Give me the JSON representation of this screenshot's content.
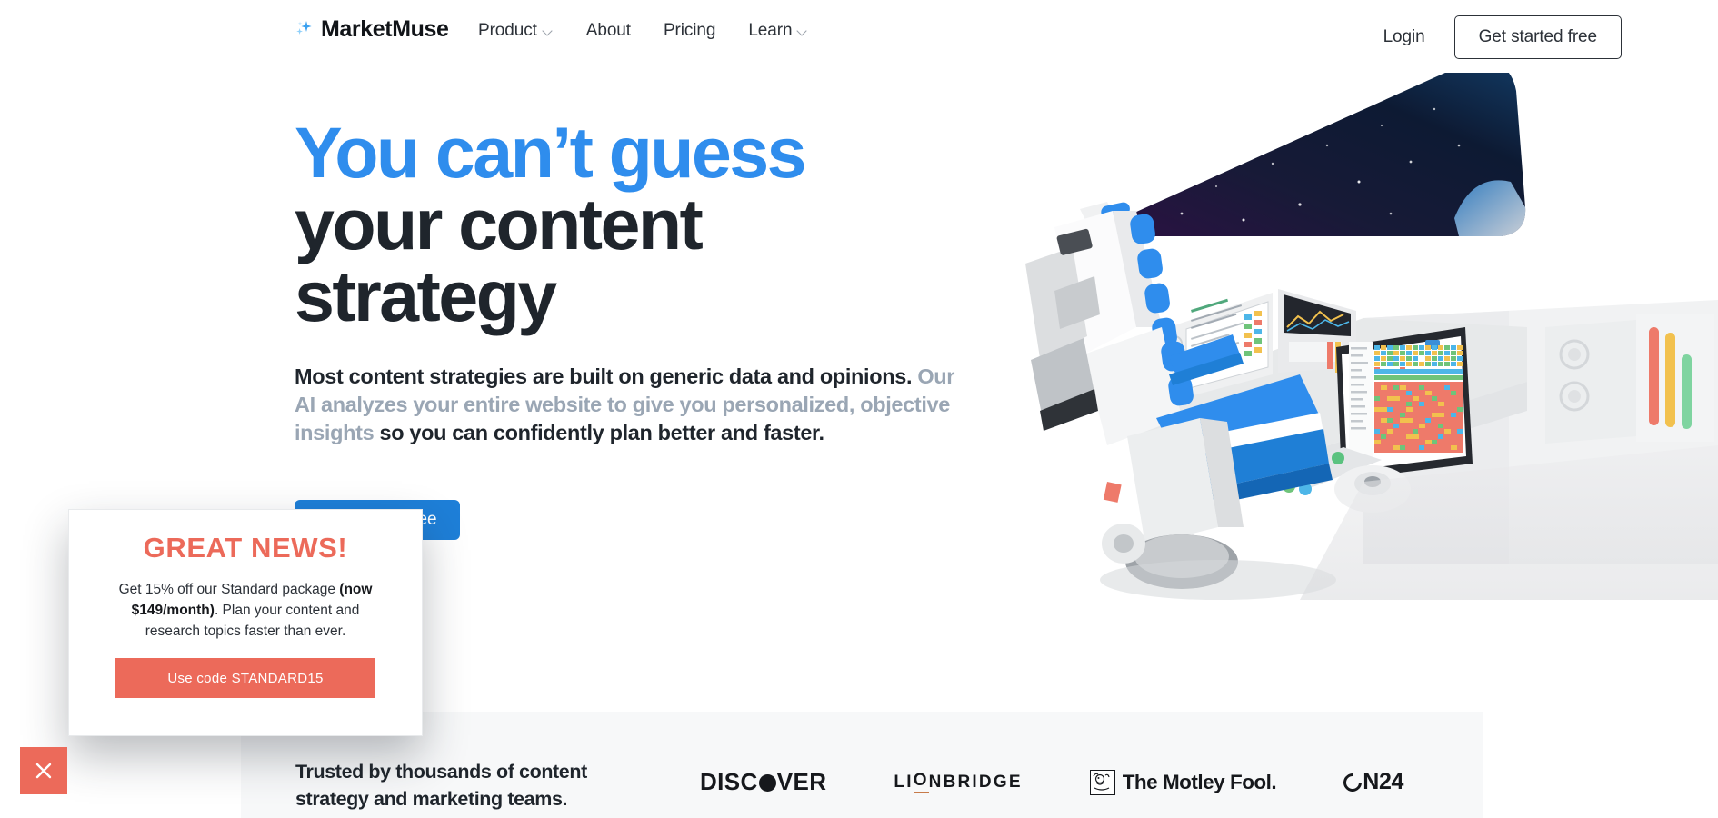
{
  "nav": {
    "brand": "MarketMuse",
    "brand_icon": "sparkle-icon",
    "links": [
      {
        "label": "Product",
        "has_dropdown": true
      },
      {
        "label": "About",
        "has_dropdown": false
      },
      {
        "label": "Pricing",
        "has_dropdown": false
      },
      {
        "label": "Learn",
        "has_dropdown": true
      }
    ],
    "login_label": "Login",
    "cta_label": "Get started free"
  },
  "hero": {
    "headline_line1": "You can’t guess",
    "headline_line2": "your content",
    "headline_line3": "strategy",
    "sub_part1": "Most content strategies are built on generic data and opinions. ",
    "sub_part2_muted": "Our AI analyzes your entire website to give you personalized, objective insights",
    "sub_part3": " so you can confidently plan better and faster.",
    "cta_label": "Get started free"
  },
  "trusted": {
    "title": "Trusted by thousands of content strategy and marketing teams.",
    "logos": [
      {
        "name": "discover",
        "text_a": "DISC",
        "text_b": "VER"
      },
      {
        "name": "lionbridge",
        "text_a": "LI",
        "text_b": "O",
        "text_c": "NBRIDGE"
      },
      {
        "name": "the-motley-fool",
        "text": "The Motley Fool."
      },
      {
        "name": "on24",
        "text": "N24"
      }
    ]
  },
  "promo": {
    "title": "GREAT NEWS!",
    "body_1": "Get 15% off our Standard package ",
    "body_bold": "(now $149/month)",
    "body_2": ". Plan your content and research topics faster than ever.",
    "button_label": "Use code STANDARD15",
    "close_icon": "close-icon"
  },
  "colors": {
    "accent_blue": "#2f8ded",
    "cta_blue": "#1e7fd8",
    "promo_red": "#ec6a5a",
    "dark": "#1f252c",
    "muted": "#9aa6b4",
    "panel_bg": "#f7f8f9"
  }
}
